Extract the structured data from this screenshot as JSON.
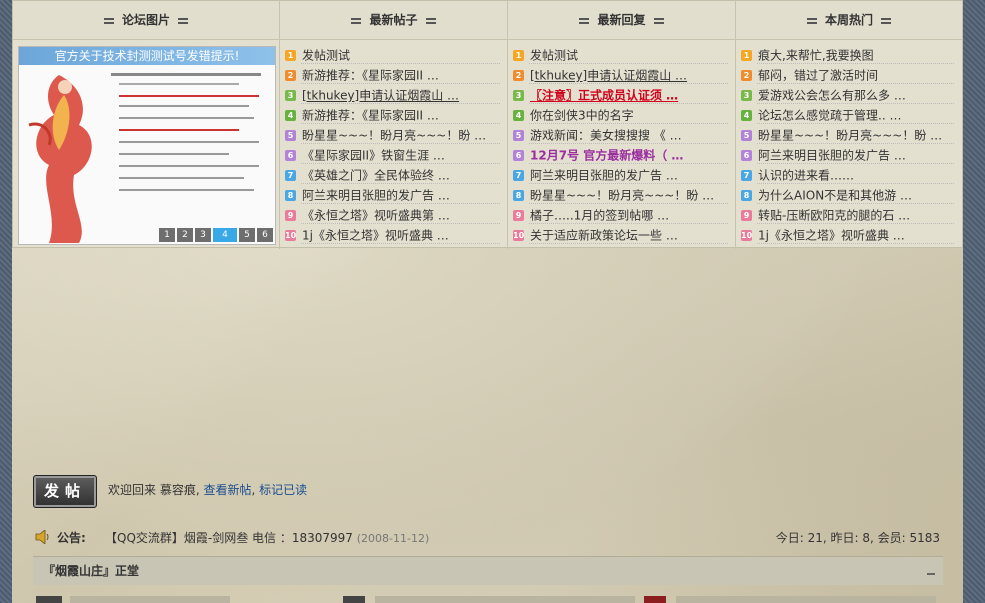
{
  "columns": {
    "photos": {
      "title": "论坛图片"
    },
    "new_posts": {
      "title": "最新帖子"
    },
    "new_replies": {
      "title": "最新回复"
    },
    "hot_week": {
      "title": "本周热门"
    }
  },
  "slideshow": {
    "caption": "官方关于技术封测测试号发错提示!",
    "pages": [
      "1",
      "2",
      "3",
      "4",
      "5",
      "6"
    ],
    "active_page": "4"
  },
  "lists": {
    "new_posts": [
      {
        "n": "1",
        "text": "发帖测试",
        "style": ""
      },
      {
        "n": "2",
        "text": "新游推荐：《星际家园II …",
        "style": ""
      },
      {
        "n": "3",
        "text": "[tkhukey]申请认证烟霞山 …",
        "style": "link"
      },
      {
        "n": "4",
        "text": "新游推荐：《星际家园II …",
        "style": ""
      },
      {
        "n": "5",
        "text": "盼星星~~~！盼月亮~~~！盼 …",
        "style": ""
      },
      {
        "n": "6",
        "text": "《星际家园II》铁窗生涯 …",
        "style": ""
      },
      {
        "n": "7",
        "text": "《英雄之门》全民体验终 …",
        "style": ""
      },
      {
        "n": "8",
        "text": "阿兰来明目张胆的发广告 …",
        "style": ""
      },
      {
        "n": "9",
        "text": "《永恒之塔》视听盛典第 …",
        "style": ""
      },
      {
        "n": "10",
        "text": "1j《永恒之塔》视听盛典 …",
        "style": ""
      }
    ],
    "new_replies": [
      {
        "n": "1",
        "text": "发帖测试",
        "style": ""
      },
      {
        "n": "2",
        "text": "[tkhukey]申请认证烟霞山 …",
        "style": "link"
      },
      {
        "n": "3",
        "text": "〖注意〗正式成员认证须 …",
        "style": "red"
      },
      {
        "n": "4",
        "text": "你在剑侠3中的名字",
        "style": ""
      },
      {
        "n": "5",
        "text": "游戏新闻：美女搜搜搜 《 …",
        "style": ""
      },
      {
        "n": "6",
        "text": "12月7号 官方最新爆料（ …",
        "style": "purple"
      },
      {
        "n": "7",
        "text": "阿兰来明目张胆的发广告 …",
        "style": ""
      },
      {
        "n": "8",
        "text": "盼星星~~~！盼月亮~~~！盼 …",
        "style": ""
      },
      {
        "n": "9",
        "text": "橘子…..1月的签到帖哪 …",
        "style": ""
      },
      {
        "n": "10",
        "text": "关于适应新政策论坛一些 …",
        "style": ""
      }
    ],
    "hot_week": [
      {
        "n": "1",
        "text": "痕大,来帮忙,我要换图",
        "style": ""
      },
      {
        "n": "2",
        "text": "郁闷，错过了激活时间",
        "style": ""
      },
      {
        "n": "3",
        "text": "爱游戏公会怎么有那么多 …",
        "style": ""
      },
      {
        "n": "4",
        "text": "论坛怎么感觉疏于管理.. …",
        "style": ""
      },
      {
        "n": "5",
        "text": "盼星星~~~！盼月亮~~~！盼 …",
        "style": ""
      },
      {
        "n": "6",
        "text": "阿兰来明目张胆的发广告 …",
        "style": ""
      },
      {
        "n": "7",
        "text": "认识的进来看……",
        "style": ""
      },
      {
        "n": "8",
        "text": "为什么AION不是和其他游 …",
        "style": ""
      },
      {
        "n": "9",
        "text": "转贴-压断欧阳克的腿的石 …",
        "style": ""
      },
      {
        "n": "10",
        "text": "1j《永恒之塔》视听盛典 …",
        "style": ""
      }
    ]
  },
  "post_button": {
    "label": "发帖"
  },
  "welcome": {
    "prefix": "欢迎回来 慕容痕,",
    "view_new": "查看新帖",
    "sep": ",",
    "mark_read": "标记已读"
  },
  "notice": {
    "label": "公告:",
    "text": "【QQ交流群】烟霞-剑网叁 电信 ：18307997",
    "date": "(2008-11-12)",
    "stats": "今日: 21, 昨日: 8, 会员: 5183"
  },
  "forum_section": {
    "title": "『烟霞山庄』正堂"
  },
  "colors": {
    "link": "#1a4d8f",
    "active_page": "#38a8e6",
    "red_notice": "#d0021b",
    "purple_notice": "#9b2fa0"
  }
}
